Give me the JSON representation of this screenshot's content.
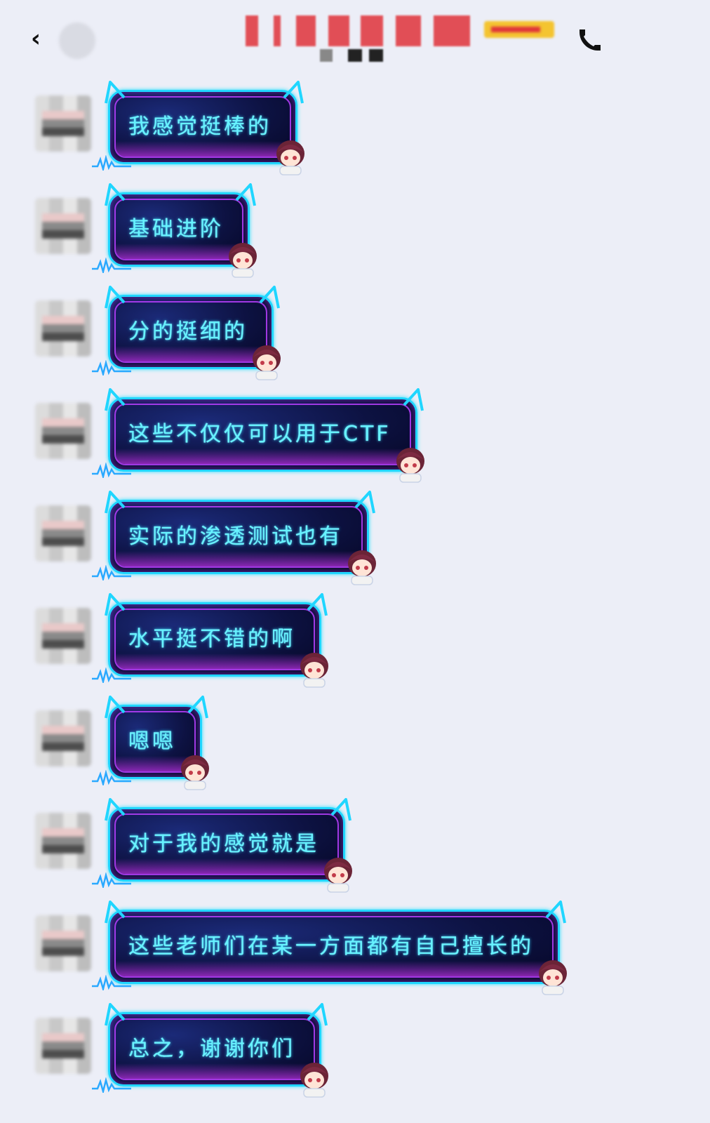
{
  "header": {
    "back_icon": "chevron-left-icon",
    "back_glyph": "‹",
    "call_icon": "phone-icon"
  },
  "colors": {
    "background": "#eceef7",
    "bubble_border": "#20d6ff",
    "bubble_text": "#66f3ff",
    "bubble_fill": "#0d1242",
    "bubble_inner_glow": "#ba40ff"
  },
  "messages": [
    {
      "text": "我感觉挺棒的"
    },
    {
      "text": "基础进阶"
    },
    {
      "text": "分的挺细的"
    },
    {
      "text": "这些不仅仅可以用于CTF"
    },
    {
      "text": "实际的渗透测试也有"
    },
    {
      "text": "水平挺不错的啊"
    },
    {
      "text": "嗯嗯"
    },
    {
      "text": "对于我的感觉就是"
    },
    {
      "text": "这些老师们在某一方面都有自己擅长的"
    },
    {
      "text": "总之，谢谢你们"
    }
  ]
}
